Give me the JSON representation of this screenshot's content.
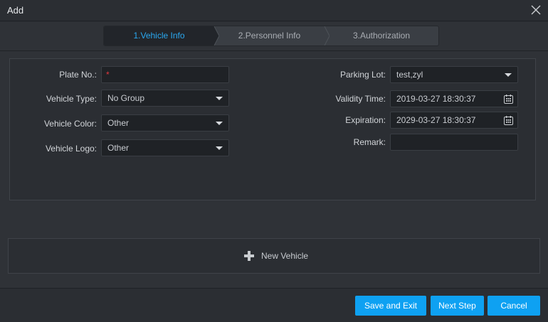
{
  "window": {
    "title": "Add"
  },
  "steps": [
    {
      "label": "1.Vehicle Info",
      "active": true
    },
    {
      "label": "2.Personnel Info",
      "active": false
    },
    {
      "label": "3.Authorization",
      "active": false
    }
  ],
  "form": {
    "plate_no": {
      "label": "Plate No.:",
      "value": "",
      "required_marker": "*"
    },
    "vehicle_type": {
      "label": "Vehicle Type:",
      "value": "No Group"
    },
    "vehicle_color": {
      "label": "Vehicle Color:",
      "value": "Other"
    },
    "vehicle_logo": {
      "label": "Vehicle Logo:",
      "value": "Other"
    },
    "parking_lot": {
      "label": "Parking Lot:",
      "value": "test,zyl"
    },
    "validity_time": {
      "label": "Validity Time:",
      "value": "2019-03-27 18:30:37"
    },
    "expiration": {
      "label": "Expiration:",
      "value": "2029-03-27 18:30:37"
    },
    "remark": {
      "label": "Remark:",
      "value": ""
    }
  },
  "new_vehicle": {
    "label": "New Vehicle",
    "icon": "plus-icon"
  },
  "buttons": {
    "save_exit": "Save and Exit",
    "next_step": "Next Step",
    "cancel": "Cancel"
  },
  "colors": {
    "accent": "#0ea1f2",
    "active_step_text": "#2aa8f0",
    "required": "#e0383e",
    "background": "#2b2e33"
  }
}
